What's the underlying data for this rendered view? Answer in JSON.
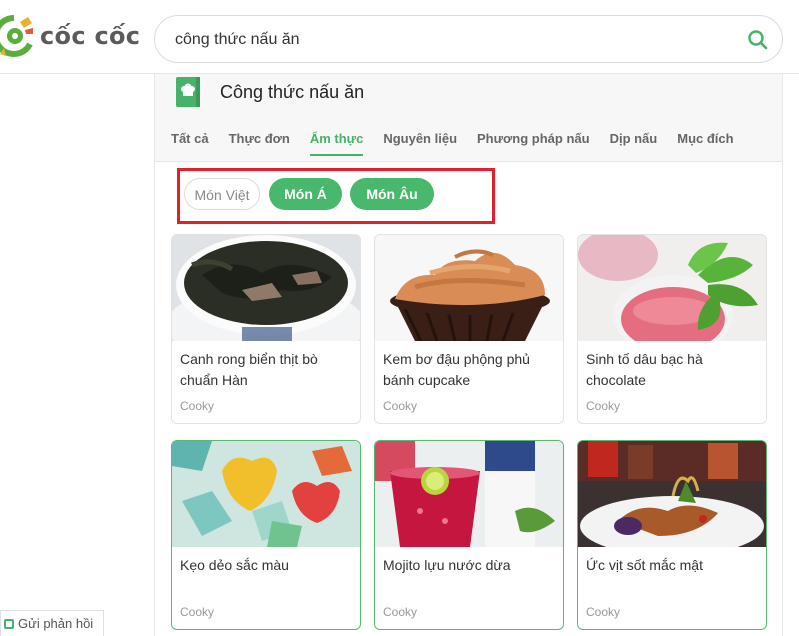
{
  "header": {
    "logo_text": "cốc cốc",
    "search": {
      "value": "công thức nấu ăn",
      "placeholder": ""
    }
  },
  "panel": {
    "title": "Công thức nấu ăn",
    "tabs": [
      {
        "label": "Tất cả",
        "active": false
      },
      {
        "label": "Thực đơn",
        "active": false
      },
      {
        "label": "Ẩm thực",
        "active": true
      },
      {
        "label": "Nguyên liệu",
        "active": false
      },
      {
        "label": "Phương pháp nấu",
        "active": false
      },
      {
        "label": "Dịp nấu",
        "active": false
      },
      {
        "label": "Mục đích",
        "active": false
      }
    ],
    "chips": [
      {
        "label": "Món Việt"
      },
      {
        "label": "Món Á"
      },
      {
        "label": "Món Âu"
      }
    ],
    "cards": [
      {
        "title": "Canh rong biển thịt bò chuẩn Hàn",
        "source": "Cooky"
      },
      {
        "title": "Kem bơ đậu phộng phủ bánh cupcake",
        "source": "Cooky"
      },
      {
        "title": "Sinh tố dâu bạc hà chocolate",
        "source": "Cooky"
      },
      {
        "title": "Kẹo dẻo sắc màu",
        "source": "Cooky"
      },
      {
        "title": "Mojito lựu nước dừa",
        "source": "Cooky"
      },
      {
        "title": "Ức vịt sốt mắc mật",
        "source": "Cooky"
      }
    ]
  },
  "feedback": {
    "label": "Gửi phản hồi"
  },
  "colors": {
    "accent": "#47b269",
    "highlight": "#e21f2d"
  }
}
